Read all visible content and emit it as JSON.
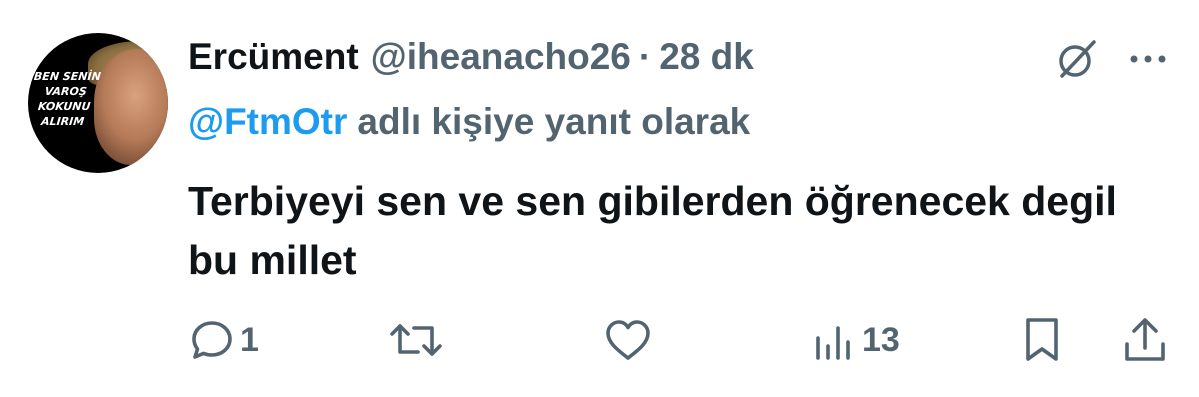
{
  "avatar": {
    "caption_lines": [
      "BEN SENİN",
      "VAROŞ",
      "KOKUNU",
      "ALIRIM"
    ]
  },
  "author": {
    "name": "Ercüment",
    "handle": "@iheanacho26",
    "separator": "·",
    "time": "28 dk"
  },
  "reply": {
    "mention": "@FtmOtr",
    "text": "adlı kişiye yanıt olarak"
  },
  "tweet": {
    "text": "Terbiyeyi sen ve sen gibilerden öğrenecek degil bu millet"
  },
  "actions": {
    "reply_count": "1",
    "views_count": "13"
  },
  "icons": {
    "grok": "grok-icon",
    "more": "more-icon",
    "reply": "reply-icon",
    "retweet": "retweet-icon",
    "like": "like-icon",
    "views": "views-icon",
    "bookmark": "bookmark-icon",
    "share": "share-icon"
  },
  "colors": {
    "text": "#0f1419",
    "secondary": "#536471",
    "link": "#1d9bf0",
    "background": "#ffffff"
  }
}
